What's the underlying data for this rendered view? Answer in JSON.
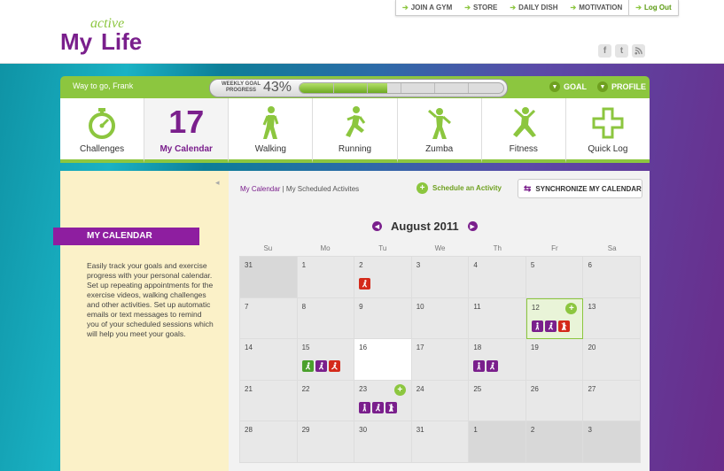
{
  "topnav": {
    "items": [
      "JOIN A GYM",
      "STORE",
      "DAILY DISH",
      "MOTIVATION"
    ],
    "logout": "Log Out"
  },
  "logo": {
    "my": "My",
    "life": "Life",
    "active": "active"
  },
  "social": {
    "facebook": "f",
    "twitter": "t",
    "rss": "r"
  },
  "greenbar": {
    "greeting": "Way to go, Frank",
    "goal_label": "WEEKLY GOAL PROGRESS",
    "goal_percent_text": "43%",
    "goal_fraction": 0.43,
    "goal_link": "GOAL",
    "profile_link": "PROFILE"
  },
  "tiles": [
    {
      "label": "Challenges",
      "icon": "stopwatch-icon"
    },
    {
      "label": "My Calendar",
      "number": "17"
    },
    {
      "label": "Walking",
      "icon": "walking-icon"
    },
    {
      "label": "Running",
      "icon": "running-icon"
    },
    {
      "label": "Zumba",
      "icon": "zumba-icon"
    },
    {
      "label": "Fitness",
      "icon": "fitness-icon"
    },
    {
      "label": "Quick Log",
      "icon": "plus-icon"
    }
  ],
  "sidebar": {
    "title": "MY CALENDAR",
    "description": "Easily track your goals and exercise progress with your personal calendar.  Set up repeating appointments for the exercise videos, walking challenges and other activities.  Set up automatic emails or text messages to remind you of your scheduled sessions which will help you meet your goals."
  },
  "main": {
    "crumb_current": "My Calendar",
    "crumb_sep": "|",
    "crumb_other": "My Scheduled Activites",
    "schedule_label": "Schedule an Activity",
    "sync_label": "SYNCHRONIZE MY CALENDAR",
    "month_title": "August 2011",
    "dows": [
      "Su",
      "Mo",
      "Tu",
      "We",
      "Th",
      "Fr",
      "Sa"
    ]
  },
  "colors": {
    "accent_green": "#8cc63f",
    "brand_purple": "#7a1f8c",
    "activity_red": "#d42a1a"
  }
}
